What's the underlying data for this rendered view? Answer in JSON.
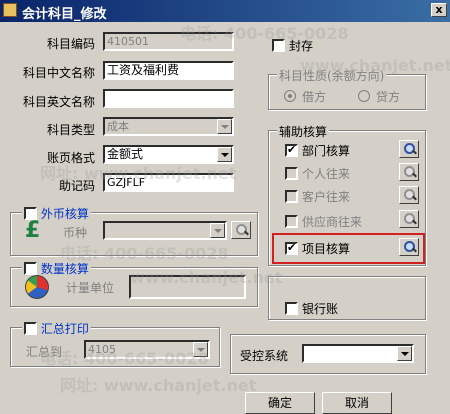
{
  "window": {
    "title": "会计科目_修改",
    "close_glyph": "x"
  },
  "form": {
    "code_label": "科目编码",
    "code_value": "410501",
    "cn_label": "科目中文名称",
    "cn_value": "工资及福利费",
    "en_label": "科目英文名称",
    "en_value": "",
    "type_label": "科目类型",
    "type_value": "成本",
    "format_label": "账页格式",
    "format_value": "金额式",
    "mnemonic_label": "助记码",
    "mnemonic_value": "GZJFLF"
  },
  "sealed": {
    "label": "封存",
    "checked": false
  },
  "nature": {
    "title": "科目性质(余额方向)",
    "debit": "借方",
    "credit": "贷方",
    "selected": "debit"
  },
  "aux": {
    "title": "辅助核算",
    "items": [
      {
        "label": "部门核算",
        "checked": true,
        "enabled": true
      },
      {
        "label": "个人往来",
        "checked": false,
        "enabled": false
      },
      {
        "label": "客户往来",
        "checked": false,
        "enabled": false
      },
      {
        "label": "供应商往来",
        "checked": false,
        "enabled": false
      },
      {
        "label": "项目核算",
        "checked": true,
        "enabled": true
      }
    ]
  },
  "bank_account": {
    "label": "银行账",
    "checked": false
  },
  "foreign": {
    "title": "外币核算",
    "currency_label": "币种",
    "currency_value": ""
  },
  "quantity": {
    "title": "数量核算",
    "unit_label": "计量单位",
    "unit_value": ""
  },
  "summary": {
    "title": "汇总打印",
    "to_label": "汇总到",
    "to_value": "4105"
  },
  "control": {
    "label": "受控系统",
    "value": ""
  },
  "buttons": {
    "ok": "确定",
    "cancel": "取消"
  },
  "watermark": {
    "phone": "电话: 400-665-0028",
    "site": "网址: www.chanjet.net",
    "site_short": "www.chanjet.net"
  },
  "colors": {
    "titlebar": "#0a246a",
    "highlight": "#d02020",
    "face": "#d4d0c8"
  }
}
